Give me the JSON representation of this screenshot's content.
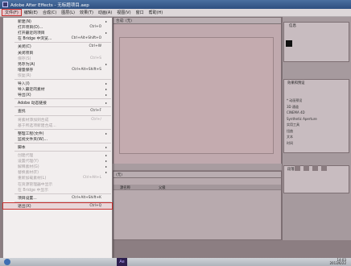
{
  "window": {
    "title": "Adobe After Effects - 无标题项目.aep"
  },
  "menu_bar": [
    "文件(F)",
    "编辑(E)",
    "合成(C)",
    "图层(L)",
    "效果(T)",
    "动画(A)",
    "视图(V)",
    "窗口",
    "帮助(H)"
  ],
  "file_menu": [
    {
      "label": "新建(N)",
      "shortcut": "",
      "arrow": "▸",
      "disabled": false
    },
    {
      "label": "打开项目(O)...",
      "shortcut": "Ctrl+O",
      "arrow": "",
      "disabled": false
    },
    {
      "label": "打开最近的项目",
      "shortcut": "",
      "arrow": "▸",
      "disabled": false
    },
    {
      "label": "在 Bridge 中浏览...",
      "shortcut": "Ctrl+Alt+Shift+O",
      "arrow": "",
      "disabled": false
    },
    {
      "sep": true
    },
    {
      "label": "关闭(C)",
      "shortcut": "Ctrl+W",
      "arrow": "",
      "disabled": false
    },
    {
      "label": "关闭项目",
      "shortcut": "",
      "arrow": "",
      "disabled": false
    },
    {
      "label": "保存(S)",
      "shortcut": "Ctrl+S",
      "arrow": "",
      "disabled": true
    },
    {
      "label": "另存为(A)",
      "shortcut": "",
      "arrow": "▸",
      "disabled": false
    },
    {
      "label": "增量保存",
      "shortcut": "Ctrl+Alt+Shift+S",
      "arrow": "",
      "disabled": false
    },
    {
      "label": "恢复(R)",
      "shortcut": "",
      "arrow": "",
      "disabled": true
    },
    {
      "sep": true
    },
    {
      "label": "导入(I)",
      "shortcut": "",
      "arrow": "▸",
      "disabled": false
    },
    {
      "label": "导入最近的素材",
      "shortcut": "",
      "arrow": "▸",
      "disabled": false
    },
    {
      "label": "导出(X)",
      "shortcut": "",
      "arrow": "▸",
      "disabled": false
    },
    {
      "sep": true
    },
    {
      "label": "Adobe 动态链接",
      "shortcut": "",
      "arrow": "▸",
      "disabled": false
    },
    {
      "sep": true
    },
    {
      "label": "查找",
      "shortcut": "Ctrl+F",
      "arrow": "",
      "disabled": false
    },
    {
      "sep": true
    },
    {
      "label": "将素材添加到合成",
      "shortcut": "Ctrl+/",
      "arrow": "",
      "disabled": true
    },
    {
      "label": "基于所选项新建合成...",
      "shortcut": "",
      "arrow": "",
      "disabled": true
    },
    {
      "sep": true
    },
    {
      "label": "整理工程(文件)",
      "shortcut": "",
      "arrow": "▸",
      "disabled": false
    },
    {
      "label": "监视文件夹(W)...",
      "shortcut": "",
      "arrow": "",
      "disabled": false
    },
    {
      "sep": true
    },
    {
      "label": "脚本",
      "shortcut": "",
      "arrow": "▸",
      "disabled": false
    },
    {
      "sep": true
    },
    {
      "label": "创建代理",
      "shortcut": "",
      "arrow": "▸",
      "disabled": true
    },
    {
      "label": "设置代理(Y)",
      "shortcut": "",
      "arrow": "▸",
      "disabled": true
    },
    {
      "label": "解释素材(G)",
      "shortcut": "",
      "arrow": "▸",
      "disabled": true
    },
    {
      "label": "替换素材(E)",
      "shortcut": "",
      "arrow": "▸",
      "disabled": true
    },
    {
      "label": "重新加载素材(L)",
      "shortcut": "Ctrl+Alt+L",
      "arrow": "",
      "disabled": true
    },
    {
      "label": "在资源管理器中显示",
      "shortcut": "",
      "arrow": "",
      "disabled": true
    },
    {
      "label": "在 Bridge 中显示",
      "shortcut": "",
      "arrow": "",
      "disabled": true
    },
    {
      "sep": true
    },
    {
      "label": "项目设置...",
      "shortcut": "Ctrl+Alt+Shift+K",
      "arrow": "",
      "disabled": false
    },
    {
      "sep": true
    },
    {
      "label": "退出(X)",
      "shortcut": "Ctrl+Q",
      "arrow": "",
      "disabled": false,
      "highlight": true
    }
  ],
  "panels": {
    "comp_header": "合成: (无)",
    "info_header": "信息",
    "effects_header": "效果和预设",
    "timeline_header": "(无)",
    "timeline_col": "源名称",
    "timeline_col2": "父级",
    "paragraph_header": "段落"
  },
  "effects_list": [
    "* 动画预设",
    "3D 通道",
    "CINEMA 4D",
    "Synthetic Aperture",
    "实用工具",
    "扭曲",
    "文本",
    "时间"
  ],
  "taskbar": {
    "app_label": "Ae",
    "clock_time": "14:03",
    "clock_date": "2013/6/22"
  }
}
